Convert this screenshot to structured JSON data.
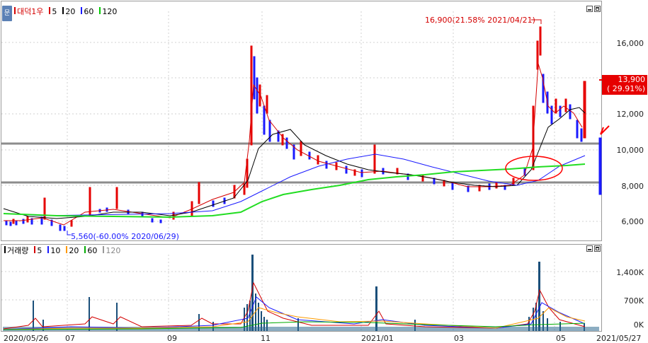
{
  "price_pane": {
    "legend": [
      {
        "label": "대덕1우",
        "color": "#d40000"
      },
      {
        "label": "5",
        "color": "#d40000"
      },
      {
        "label": "20",
        "color": "#000000"
      },
      {
        "label": "60",
        "color": "#1a1aff"
      },
      {
        "label": "120",
        "color": "#00cc00"
      }
    ],
    "y_ticks": [
      "16,000",
      "14,000",
      "12,000",
      "10,000",
      "8,000",
      "6,000"
    ],
    "max_annotation": "16,900(21.58% 2021/04/21)",
    "min_annotation": "5,560(-60.00% 2020/06/29)",
    "current_price": "13,900",
    "current_change": "( 29.91%)",
    "side_icon": "문"
  },
  "volume_pane": {
    "legend": [
      {
        "label": "거래량",
        "color": "#000000"
      },
      {
        "label": "5",
        "color": "#d40000"
      },
      {
        "label": "10",
        "color": "#1a1aff"
      },
      {
        "label": "20",
        "color": "#ff9900"
      },
      {
        "label": "60",
        "color": "#00aa00"
      },
      {
        "label": "120",
        "color": "#999999"
      }
    ],
    "y_ticks": [
      "1,400K",
      "700K",
      "0K"
    ]
  },
  "x_axis": {
    "labels": [
      "2020/05/26",
      "07",
      "09",
      "11",
      "2021/01",
      "03",
      "05",
      "2021/05/27"
    ]
  },
  "colors": {
    "up": "#e60000",
    "down": "#1a1aff",
    "support_line": "#909090",
    "highlight": "#ff0000"
  },
  "chart_data": {
    "type": "candlestick",
    "title": "",
    "xlabel": "",
    "ylabel": "",
    "ylim": [
      5000,
      17000
    ],
    "support_levels": [
      10300,
      8150
    ],
    "milestones": [
      {
        "date": "2020/05/26",
        "close": 6000
      },
      {
        "date": "2020/06/29",
        "low": 5560
      },
      {
        "date": "2020/07",
        "close": 6300
      },
      {
        "date": "2020/09",
        "close": 6300
      },
      {
        "date": "2020/10",
        "close": 7200
      },
      {
        "date": "2020/10 late",
        "high": 15800
      },
      {
        "date": "2020/11",
        "close": 11000
      },
      {
        "date": "2020/12",
        "close": 8800
      },
      {
        "date": "2021/01",
        "close": 8600
      },
      {
        "date": "2021/03",
        "close": 7700
      },
      {
        "date": "2021/04",
        "close": 8800
      },
      {
        "date": "2021/04/21",
        "high": 16900
      },
      {
        "date": "2021/05",
        "close": 11500
      },
      {
        "date": "2021/05/27",
        "close": 13900
      }
    ]
  }
}
